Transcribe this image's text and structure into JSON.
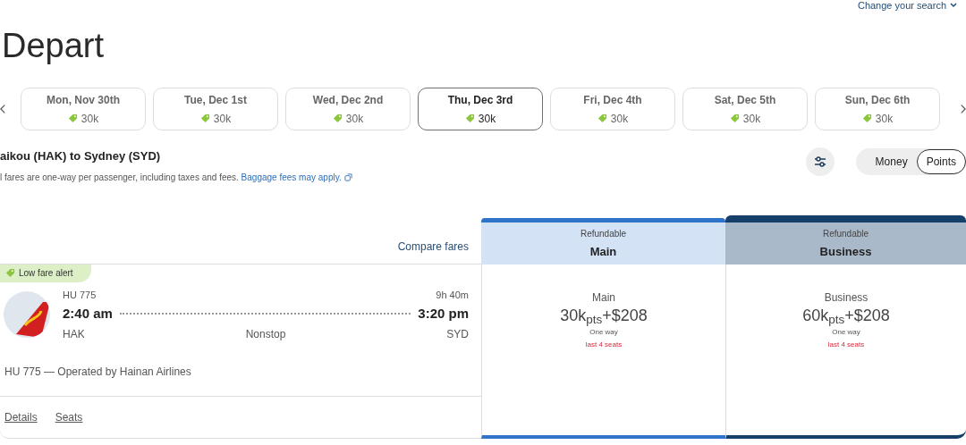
{
  "change_search": "Change your search",
  "heading": "Depart",
  "dates": [
    {
      "label": "Mon, Nov 30th",
      "price": "30k",
      "selected": false
    },
    {
      "label": "Tue, Dec 1st",
      "price": "30k",
      "selected": false
    },
    {
      "label": "Wed, Dec 2nd",
      "price": "30k",
      "selected": false
    },
    {
      "label": "Thu, Dec 3rd",
      "price": "30k",
      "selected": true
    },
    {
      "label": "Fri, Dec 4th",
      "price": "30k",
      "selected": false
    },
    {
      "label": "Sat, Dec 5th",
      "price": "30k",
      "selected": false
    },
    {
      "label": "Sun, Dec 6th",
      "price": "30k",
      "selected": false
    }
  ],
  "route": "aikou (HAK) to Sydney (SYD)",
  "fare_note": "l fares are one-way per passenger, including taxes and fees.",
  "baggage_link": "Baggage fees may apply.",
  "currency_toggle": [
    {
      "label": "Money",
      "selected": false
    },
    {
      "label": "Points",
      "selected": true
    }
  ],
  "compare_fares": "Compare fares",
  "fare_columns": [
    {
      "kind": "main",
      "tag": "Refundable",
      "name": "Main"
    },
    {
      "kind": "business",
      "tag": "Refundable",
      "name": "Business"
    }
  ],
  "flight": {
    "badge": "Low fare alert",
    "number": "HU 775",
    "duration": "9h 40m",
    "depart_time": "2:40 am",
    "arrive_time": "3:20 pm",
    "origin": "HAK",
    "stops": "Nonstop",
    "destination": "SYD",
    "operator": "HU 775 — Operated by Hainan Airlines",
    "links": [
      "Details",
      "Seats"
    ],
    "fares": [
      {
        "cabin": "Main",
        "price": "30k$_{pts}$+$208",
        "trip": "One way",
        "seats": "last 4 seats"
      },
      {
        "cabin": "Business",
        "price": "60k$_{pts}$+$208",
        "trip": "One way",
        "seats": "last 4 seats"
      }
    ]
  }
}
